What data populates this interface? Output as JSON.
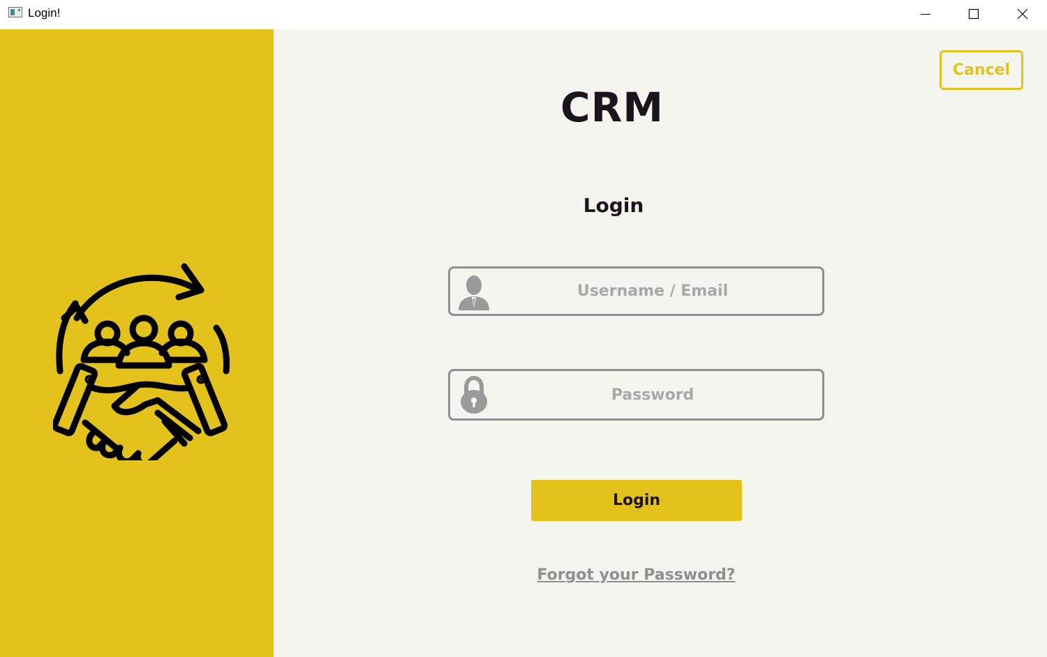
{
  "window": {
    "title": "Login!",
    "controls": {
      "minimize": "minimize-icon",
      "maximize": "maximize-icon",
      "close": "close-icon"
    }
  },
  "illustration": {
    "icon": "handshake-team-icon"
  },
  "header": {
    "cancel_label": "Cancel"
  },
  "app_name": "CRM",
  "form": {
    "heading": "Login",
    "username": {
      "placeholder": "Username / Email",
      "value": "",
      "icon": "user-icon"
    },
    "password": {
      "placeholder": "Password",
      "value": "",
      "icon": "lock-icon"
    },
    "submit_label": "Login",
    "forgot_label": "Forgot your Password?"
  },
  "colors": {
    "accent": "#e3c21c",
    "panel_background": "#f5f5f0",
    "text_dark": "#1c141c",
    "muted_gray": "#8f8f8f",
    "placeholder_gray": "#a8a8a8"
  }
}
